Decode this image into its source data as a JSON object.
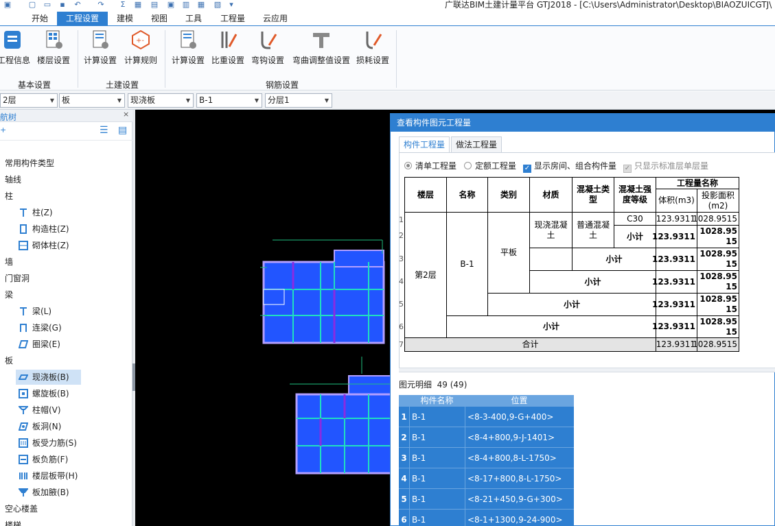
{
  "titlebar": {
    "title": "广联达BIM土建计量平台 GTJ2018 - [C:\\Users\\Administrator\\Desktop\\BIAOZUICGTJ\\"
  },
  "menu": {
    "tabs": [
      "开始",
      "工程设置",
      "建模",
      "视图",
      "工具",
      "工程量",
      "云应用"
    ],
    "active_index": 1
  },
  "ribbon": {
    "buttons": [
      "工程信息",
      "楼层设置",
      "计算设置",
      "计算规则",
      "计算设置",
      "比重设置",
      "弯钩设置",
      "弯曲调整值设置",
      "损耗设置"
    ],
    "groups": [
      "基本设置",
      "土建设置",
      "钢筋设置"
    ]
  },
  "combos": [
    "2层",
    "板",
    "现浇板",
    "B-1",
    "分层1"
  ],
  "nav": {
    "title": "导航树",
    "items": [
      "常用构件类型",
      "轴线",
      "柱",
      "柱(Z)",
      "构造柱(Z)",
      "砌体柱(Z)",
      "墙",
      "门窗洞",
      "梁",
      "梁(L)",
      "连梁(G)",
      "圈梁(E)",
      "板",
      "现浇板(B)",
      "螺旋板(B)",
      "柱帽(V)",
      "板洞(N)",
      "板受力筋(S)",
      "板负筋(F)",
      "楼层板带(H)",
      "板加腋(B)",
      "空心楼盖",
      "楼梯"
    ]
  },
  "dialog": {
    "title": "查看构件图元工程量",
    "tabs": [
      "构件工程量",
      "做法工程量"
    ],
    "options": {
      "list_qty": "清单工程量",
      "quota_qty": "定额工程量",
      "show_room": "显示房间、组合构件量",
      "only_std": "只显示标准层单层量"
    },
    "table": {
      "h_floor": "楼层",
      "h_name": "名称",
      "h_type": "类别",
      "h_material": "材质",
      "h_concrete_type": "混凝土类型",
      "h_concrete_grade": "混凝土强度等级",
      "h_qty_name": "工程量名称",
      "h_volume": "体积(m3)",
      "h_area": "投影面积(m2)",
      "row_nums": [
        "1",
        "2",
        "3",
        "4",
        "5",
        "6",
        "7"
      ],
      "floor": "第2层",
      "name": "B-1",
      "type": "平板",
      "material": "现浇混凝土",
      "concrete_type": "普通混凝土",
      "grade": "C30",
      "subtotal": "小计",
      "total": "合计",
      "volume": "123.9311",
      "area_wrapped": "1028.9515",
      "area": "1028.9515"
    },
    "detail": {
      "label": "图元明细",
      "count": "49 (49)",
      "col_name": "构件名称",
      "col_pos": "位置",
      "rows": [
        {
          "n": "1",
          "name": "B-1",
          "pos": "<8-3-400,9-G+400>"
        },
        {
          "n": "2",
          "name": "B-1",
          "pos": "<8-4+800,9-J-1401>"
        },
        {
          "n": "3",
          "name": "B-1",
          "pos": "<8-4+800,8-L-1750>"
        },
        {
          "n": "4",
          "name": "B-1",
          "pos": "<8-17+800,8-L-1750>"
        },
        {
          "n": "5",
          "name": "B-1",
          "pos": "<8-21+450,9-G+300>"
        },
        {
          "n": "6",
          "name": "B-1",
          "pos": "<8-1+1300,9-24-900>"
        }
      ]
    }
  },
  "colors": {
    "accent": "#2e7fd1",
    "canvas": "#000000",
    "slab_fill": "#2255ff"
  }
}
